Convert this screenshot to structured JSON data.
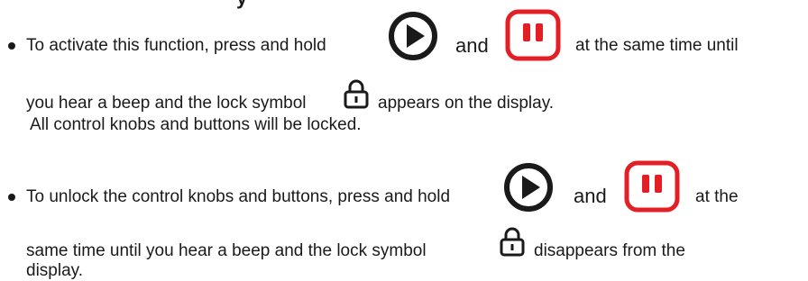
{
  "header_fragment": "y",
  "items": [
    {
      "line1_prefix": "To activate this function, press and hold",
      "and_label": "and",
      "line1_suffix": "at the same time until",
      "line2_prefix": "you hear a beep and the lock symbol",
      "line2_suffix": "appears on the display.",
      "line3": "All control knobs and buttons will be locked."
    },
    {
      "line1_prefix": "To unlock the control knobs and buttons, press and hold",
      "and_label": "and",
      "line1_suffix": "at the",
      "line2_prefix": "same time until you hear a beep and the lock symbol",
      "line2_suffix": "disappears from the",
      "line3": "display."
    }
  ],
  "icons": {
    "play": "play-button-icon",
    "pause": "pause-button-icon",
    "lock": "lock-icon"
  },
  "colors": {
    "play_icon": "#1a1a1a",
    "pause_icon": "#e31e24",
    "lock_icon": "#1a1a1a"
  }
}
